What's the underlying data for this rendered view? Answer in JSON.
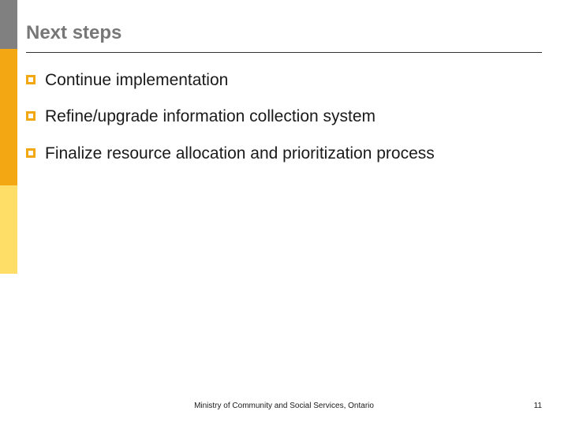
{
  "slide": {
    "title": "Next steps",
    "bullets": [
      "Continue implementation",
      "Refine/upgrade information collection system",
      "Finalize resource allocation and prioritization process"
    ],
    "footer": "Ministry of Community and Social Services, Ontario",
    "pageNumber": "11"
  }
}
